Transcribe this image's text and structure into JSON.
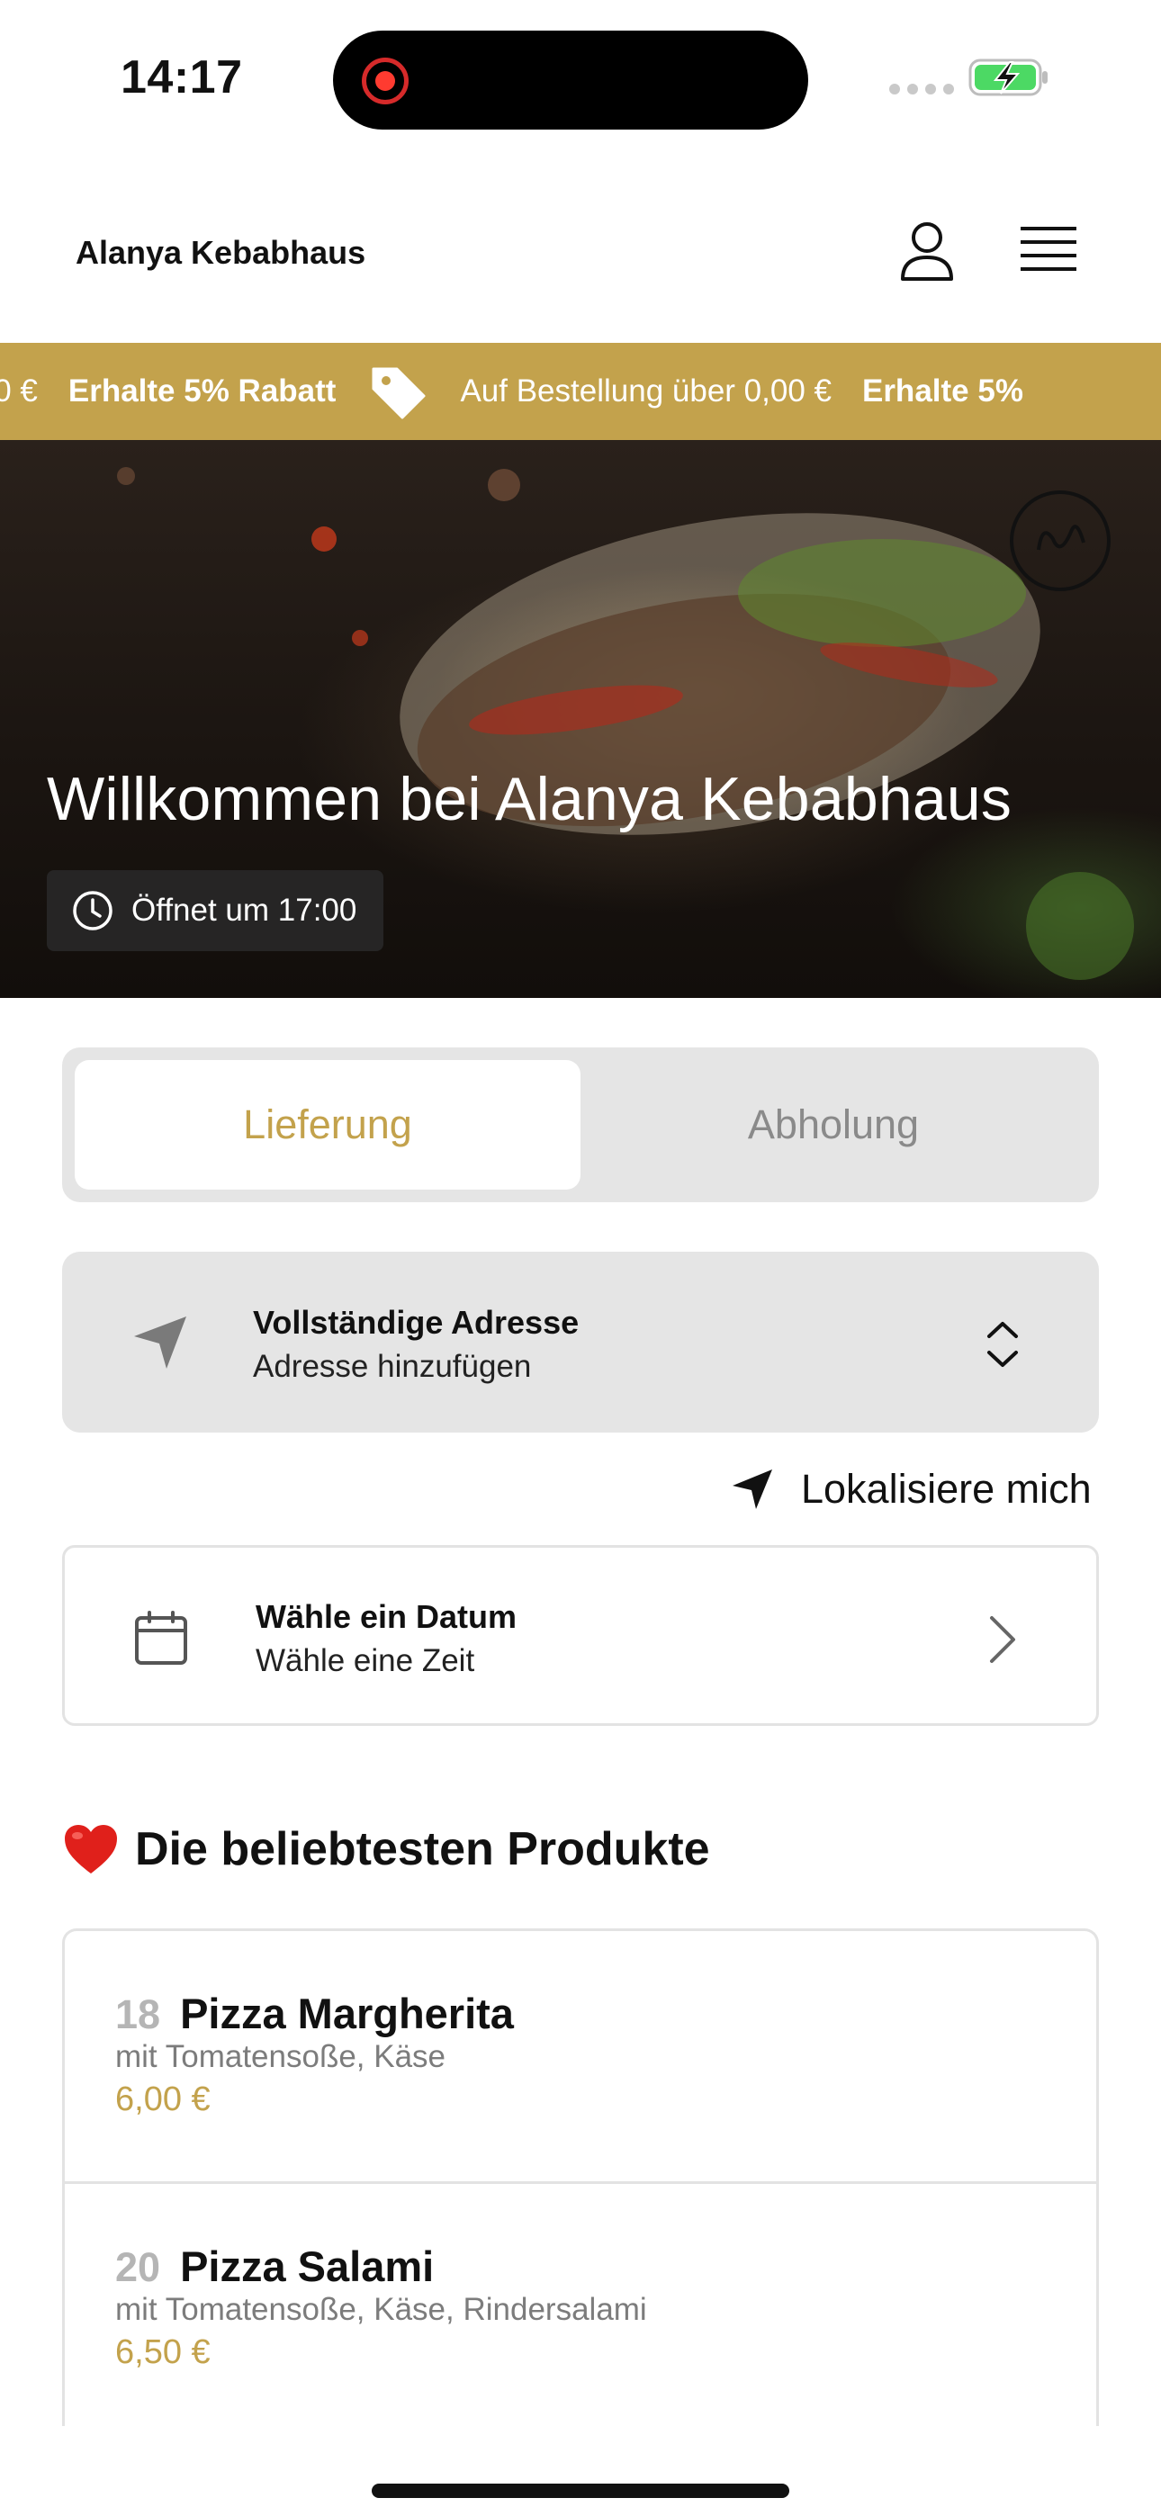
{
  "status_bar": {
    "time": "14:17"
  },
  "header": {
    "brand": "Alanya Kebabhaus"
  },
  "promo": {
    "items": ",00 € | Erhalte 5% Rabatt | Auf Bestellung über 0,00 € | Erhalte 5%",
    "amount_prefix": ",00 €",
    "discount_label": "Erhalte 5% Rabatt",
    "order_condition": "Auf Bestellung über 0,00 €",
    "discount_repeat": "Erhalte 5%"
  },
  "hero": {
    "title": "Willkommen bei Alanya Kebabhaus",
    "open_status": "Öffnet um 17:00"
  },
  "mode_toggle": {
    "delivery_label": "Lieferung",
    "pickup_label": "Abholung",
    "selected": "Lieferung"
  },
  "address": {
    "title": "Vollständige Adresse",
    "subtitle": "Adresse hinzufügen"
  },
  "locate": {
    "label": "Lokalisiere mich"
  },
  "schedule": {
    "title": "Wähle ein Datum",
    "subtitle": "Wähle eine Zeit"
  },
  "popular": {
    "title": "Die beliebtesten Produkte",
    "products": [
      {
        "number": "18",
        "name": "Pizza Margherita",
        "description": "mit Tomatensoße, Käse",
        "price": "6,00 €"
      },
      {
        "number": "20",
        "name": "Pizza Salami",
        "description": "mit Tomatensoße, Käse, Rindersalami",
        "price": "6,50 €"
      }
    ]
  },
  "colors": {
    "accent": "#c3a24c",
    "card_bg": "#e5e5e5",
    "text": "#111111"
  },
  "icons": [
    "record-icon",
    "signal-icon",
    "battery-charging-icon",
    "user-icon",
    "menu-icon",
    "tag-icon",
    "halal-logo",
    "clock-icon",
    "navigation-arrow-icon",
    "chevron-up-down-icon",
    "location-arrow-icon",
    "calendar-icon",
    "chevron-right-icon",
    "heart-icon"
  ]
}
